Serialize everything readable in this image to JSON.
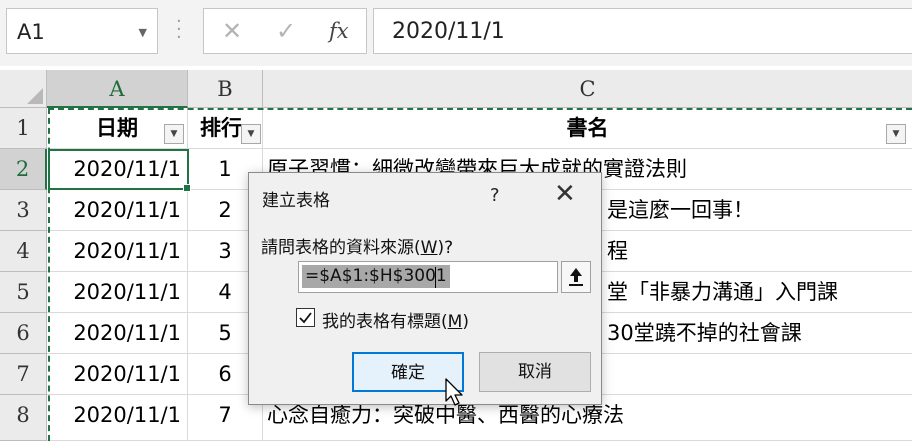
{
  "formula_bar": {
    "name_box": "A1",
    "cancel_icon": "✕",
    "enter_icon": "✓",
    "fx_label": "fx",
    "formula": "2020/11/1"
  },
  "columns": [
    "A",
    "B",
    "C"
  ],
  "header_row": {
    "row": "1",
    "a": "日期",
    "b": "排行",
    "c": "書名"
  },
  "rows": [
    {
      "row": "2",
      "a": "2020/11/1",
      "b": "1",
      "c": "原子習慣：細微改變帶來巨大成就的實證法則"
    },
    {
      "row": "3",
      "a": "2020/11/1",
      "b": "2",
      "c": "是這麼一回事！"
    },
    {
      "row": "4",
      "a": "2020/11/1",
      "b": "3",
      "c": "程"
    },
    {
      "row": "5",
      "a": "2020/11/1",
      "b": "4",
      "c": "堂「非暴力溝通」入門課"
    },
    {
      "row": "6",
      "a": "2020/11/1",
      "b": "5",
      "c": "30堂蹺不掉的社會課"
    },
    {
      "row": "7",
      "a": "2020/11/1",
      "b": "6",
      "c": ""
    },
    {
      "row": "8",
      "a": "2020/11/1",
      "b": "7",
      "c": "心念自癒力：突破中醫、西醫的心療法"
    }
  ],
  "dialog": {
    "title": "建立表格",
    "help": "?",
    "close": "✕",
    "prompt_pre": "請問表格的資料來源(",
    "prompt_key": "W",
    "prompt_post": ")?",
    "range_value": "=$A$1:$H$3001",
    "has_headers_pre": "我的表格有標題(",
    "has_headers_key": "M",
    "has_headers_post": ")",
    "has_headers_checked": true,
    "ok_label": "確定",
    "cancel_label": "取消"
  },
  "colors": {
    "accent_green": "#217346",
    "focus_blue": "#0078d7"
  }
}
